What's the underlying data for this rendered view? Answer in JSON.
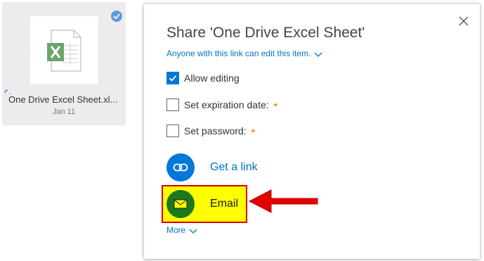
{
  "file_tile": {
    "name": "One Drive Excel Sheet.xl...",
    "date": "Jan 11",
    "icon": "excel-file-icon",
    "selected": true
  },
  "share_dialog": {
    "title": "Share 'One Drive Excel Sheet'",
    "permission_link": "Anyone with this link can edit this item.",
    "options": [
      {
        "label": "Allow editing",
        "checked": true
      },
      {
        "label": "Set expiration date:",
        "checked": false,
        "premium": true
      },
      {
        "label": "Set password:",
        "checked": false,
        "premium": true
      }
    ],
    "actions": [
      {
        "label": "Get a link",
        "icon": "link-icon",
        "color": "#0078d7"
      },
      {
        "label": "Email",
        "icon": "envelope-icon",
        "color": "#1a7a1a"
      }
    ],
    "more_label": "More",
    "premium_symbol": "✦"
  },
  "annotation": {
    "highlight_color": "#ffff00",
    "border_color": "#e00000",
    "arrow_color": "#e00000"
  }
}
